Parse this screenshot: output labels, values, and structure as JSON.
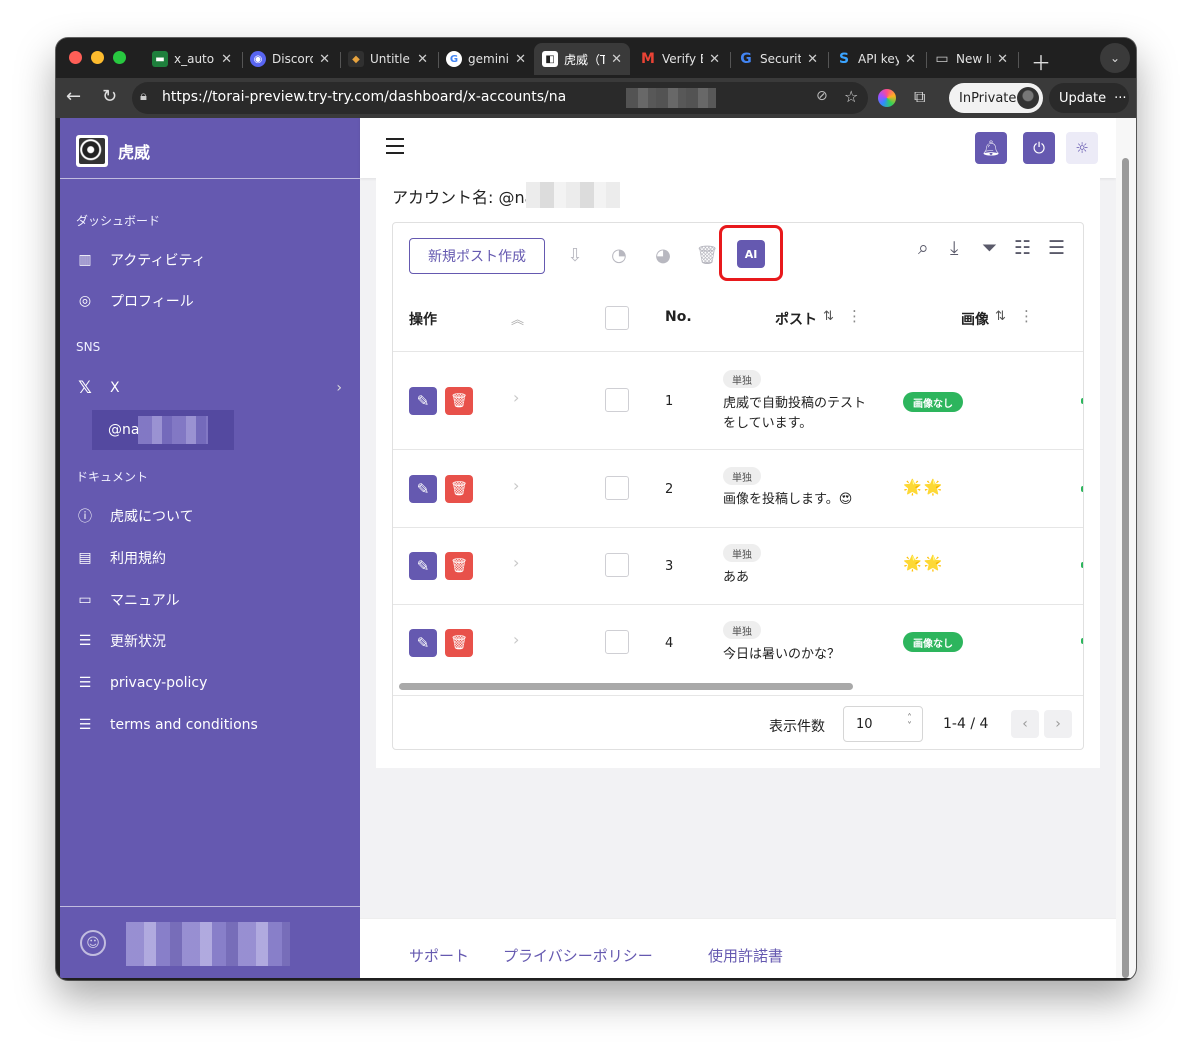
{
  "browser": {
    "tabs": [
      {
        "title": "x_autol",
        "fav": "▬",
        "fav_bg": "#1e7f3c"
      },
      {
        "title": "Discord",
        "fav": "◉",
        "fav_bg": "#5865f2"
      },
      {
        "title": "Untitle",
        "fav": "◆",
        "fav_bg": "#303030"
      },
      {
        "title": "gemini",
        "fav": "G",
        "fav_bg": "#ffffff"
      },
      {
        "title": "虎威（T",
        "fav": "◧",
        "fav_bg": "#ffffff"
      },
      {
        "title": "Verify E",
        "fav": "M",
        "fav_bg": "#ffffff"
      },
      {
        "title": "Securit",
        "fav": "G",
        "fav_bg": "#ffffff"
      },
      {
        "title": "API key",
        "fav": "S",
        "fav_bg": "#303030"
      },
      {
        "title": "New In",
        "fav": "▭",
        "fav_bg": "#303030"
      }
    ],
    "url": "https://torai-preview.try-try.com/dashboard/x-accounts/na",
    "inprivate_label": "InPrivate",
    "update_label": "Update"
  },
  "sidebar": {
    "app_name": "虎威",
    "sections": {
      "dashboard": "ダッシュボード",
      "sns": "SNS",
      "docs": "ドキュメント"
    },
    "dashboard_items": [
      {
        "label": "アクティビティ",
        "icon": "bar-chart-icon"
      },
      {
        "label": "プロフィール",
        "icon": "user-circle-icon"
      }
    ],
    "sns_item": {
      "label": "X",
      "icon": "x-logo-icon"
    },
    "sub_account": "@na",
    "doc_items": [
      {
        "label": "虎威について",
        "icon": "info-icon"
      },
      {
        "label": "利用規約",
        "icon": "document-icon"
      },
      {
        "label": "マニュアル",
        "icon": "book-icon"
      },
      {
        "label": "更新状況",
        "icon": "list-icon"
      },
      {
        "label": "privacy-policy",
        "icon": "list-icon"
      },
      {
        "label": "terms and conditions",
        "icon": "list-icon"
      }
    ]
  },
  "main": {
    "account_label": "アカウント名: @na",
    "new_post_label": "新規ポスト作成",
    "ai_label": "AI",
    "table": {
      "headers": {
        "actions": "操作",
        "no": "No.",
        "post": "ポスト",
        "image": "画像"
      },
      "rows": [
        {
          "no": "1",
          "chip": "単独",
          "text": "虎威で自動投稿のテストをしています。",
          "image": "画像なし",
          "has_image": false
        },
        {
          "no": "2",
          "chip": "単独",
          "text": "画像を投稿します。😍",
          "image": "🌟🌟",
          "has_image": true
        },
        {
          "no": "3",
          "chip": "単独",
          "text": "ああ",
          "image": "🌟🌟",
          "has_image": true
        },
        {
          "no": "4",
          "chip": "単独",
          "text": "今日は暑いのかな？",
          "image": "画像なし",
          "has_image": false
        }
      ]
    },
    "pagination": {
      "label": "表示件数",
      "per_page": "10",
      "range": "1-4 / 4"
    }
  },
  "footer": {
    "links": [
      "サポート",
      "プライバシーポリシー",
      "使用許諾書"
    ]
  },
  "colors": {
    "brand": "#6559b0",
    "danger": "#e8514a",
    "success": "#2db55d",
    "highlight": "#e8191c"
  }
}
